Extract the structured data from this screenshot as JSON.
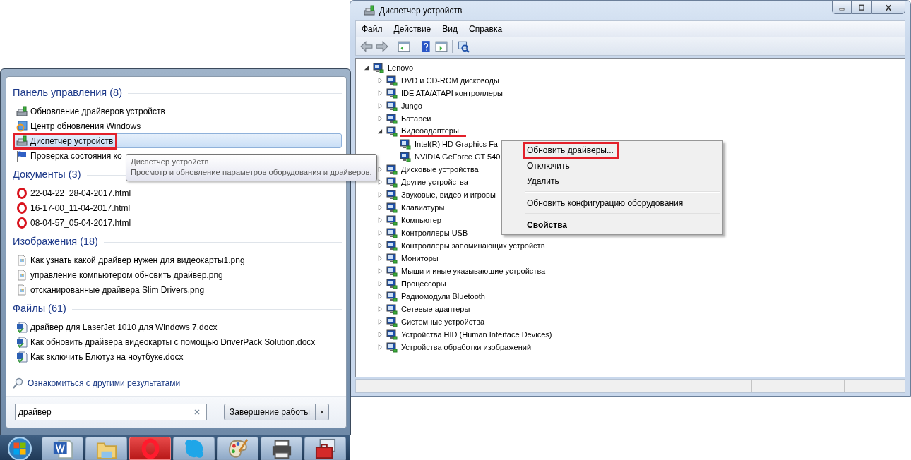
{
  "device_manager": {
    "title": "Диспетчер устройств",
    "menu": [
      "Файл",
      "Действие",
      "Вид",
      "Справка"
    ],
    "tree": [
      {
        "label": "Lenovo",
        "expanded": true,
        "marked": false,
        "children": [
          {
            "label": "DVD и CD-ROM дисководы",
            "expanded": false,
            "marked": false
          },
          {
            "label": "IDE ATA/ATAPI контроллеры",
            "expanded": false,
            "marked": false
          },
          {
            "label": "Jungo",
            "expanded": false,
            "marked": false
          },
          {
            "label": "Батареи",
            "expanded": false,
            "marked": false
          },
          {
            "label": "Видеоадаптеры",
            "expanded": true,
            "marked": true,
            "children": [
              {
                "label": "Intel(R) HD Graphics Fa",
                "marked": false
              },
              {
                "label": "NVIDIA GeForce GT 540",
                "marked": false
              }
            ]
          },
          {
            "label": "Дисковые устройства",
            "expanded": false,
            "marked": false
          },
          {
            "label": "Другие устройства",
            "expanded": false,
            "marked": false
          },
          {
            "label": "Звуковые, видео и игровы",
            "expanded": false,
            "marked": false
          },
          {
            "label": "Клавиатуры",
            "expanded": false,
            "marked": false
          },
          {
            "label": "Компьютер",
            "expanded": false,
            "marked": false
          },
          {
            "label": "Контроллеры USB",
            "expanded": false,
            "marked": false
          },
          {
            "label": "Контроллеры запоминающих устройств",
            "expanded": false,
            "marked": false
          },
          {
            "label": "Мониторы",
            "expanded": false,
            "marked": false
          },
          {
            "label": "Мыши и иные указывающие устройства",
            "expanded": false,
            "marked": false
          },
          {
            "label": "Процессоры",
            "expanded": false,
            "marked": false
          },
          {
            "label": "Радиомодули Bluetooth",
            "expanded": false,
            "marked": false
          },
          {
            "label": "Сетевые адаптеры",
            "expanded": false,
            "marked": false
          },
          {
            "label": "Системные устройства",
            "expanded": false,
            "marked": false
          },
          {
            "label": "Устройства HID (Human Interface Devices)",
            "expanded": false,
            "marked": false
          },
          {
            "label": "Устройства обработки изображений",
            "expanded": false,
            "marked": false
          }
        ]
      }
    ]
  },
  "context_menu": {
    "items": [
      {
        "kind": "command",
        "label": "Обновить драйверы...",
        "marked": true
      },
      {
        "kind": "command",
        "label": "Отключить",
        "marked": false
      },
      {
        "kind": "command",
        "label": "Удалить",
        "marked": false
      },
      {
        "kind": "separator"
      },
      {
        "kind": "command",
        "label": "Обновить конфигурацию оборудования",
        "marked": false
      },
      {
        "kind": "separator"
      },
      {
        "kind": "default",
        "label": "Свойства",
        "marked": false
      }
    ]
  },
  "start_menu": {
    "sections": [
      {
        "title": "Панель управления (8)",
        "items": [
          {
            "kind": "device",
            "label": "Обновление драйверов устройств",
            "selected": false,
            "marked": false
          },
          {
            "kind": "update",
            "label": "Центр обновления Windows",
            "selected": false,
            "marked": false
          },
          {
            "kind": "device",
            "label": "Диспетчер устройств",
            "selected": true,
            "marked": true
          },
          {
            "kind": "flag",
            "label": "Проверка состояния ко",
            "selected": false,
            "marked": false
          }
        ]
      },
      {
        "title": "Документы (3)",
        "items": [
          {
            "kind": "ring",
            "label": "22-04-22_28-04-2017.html",
            "selected": false,
            "marked": false
          },
          {
            "kind": "ring",
            "label": "16-17-00_11-04-2017.html",
            "selected": false,
            "marked": false
          },
          {
            "kind": "ring",
            "label": "08-04-57_05-04-2017.html",
            "selected": false,
            "marked": false
          }
        ]
      },
      {
        "title": "Изображения (18)",
        "items": [
          {
            "kind": "image",
            "label": "Как узнать какой драйвер нужен для видеокарты1.png",
            "selected": false,
            "marked": false
          },
          {
            "kind": "image",
            "label": "управление компьютером обновить драйвер.png",
            "selected": false,
            "marked": false
          },
          {
            "kind": "image",
            "label": "отсканированные драйвера Slim Drivers.png",
            "selected": false,
            "marked": false
          }
        ]
      },
      {
        "title": "Файлы (61)",
        "items": [
          {
            "kind": "doc",
            "label": "драйвер для LaserJet 1010 для Windows 7.docx",
            "selected": false,
            "marked": false
          },
          {
            "kind": "doc",
            "label": "Как обновить драйвера видеокарты с помощью DriverPack Solution.docx",
            "selected": false,
            "marked": false
          },
          {
            "kind": "doc",
            "label": "Как включить Блютуз на ноутбуке.docx",
            "selected": false,
            "marked": false
          }
        ]
      }
    ],
    "more_results": "Ознакомиться с другими результатами",
    "search": {
      "value": "драйвер"
    },
    "shutdown": "Завершение работы"
  },
  "tooltip": {
    "title": "Диспетчер устройств",
    "text": "Просмотр и обновление параметров оборудования и драйверов."
  },
  "taskbar": {
    "buttons": [
      {
        "kind": "document"
      },
      {
        "kind": "folder"
      },
      {
        "kind": "ring"
      },
      {
        "kind": "chat"
      },
      {
        "kind": "palette"
      },
      {
        "kind": "printer"
      },
      {
        "kind": "toolbox"
      }
    ]
  }
}
